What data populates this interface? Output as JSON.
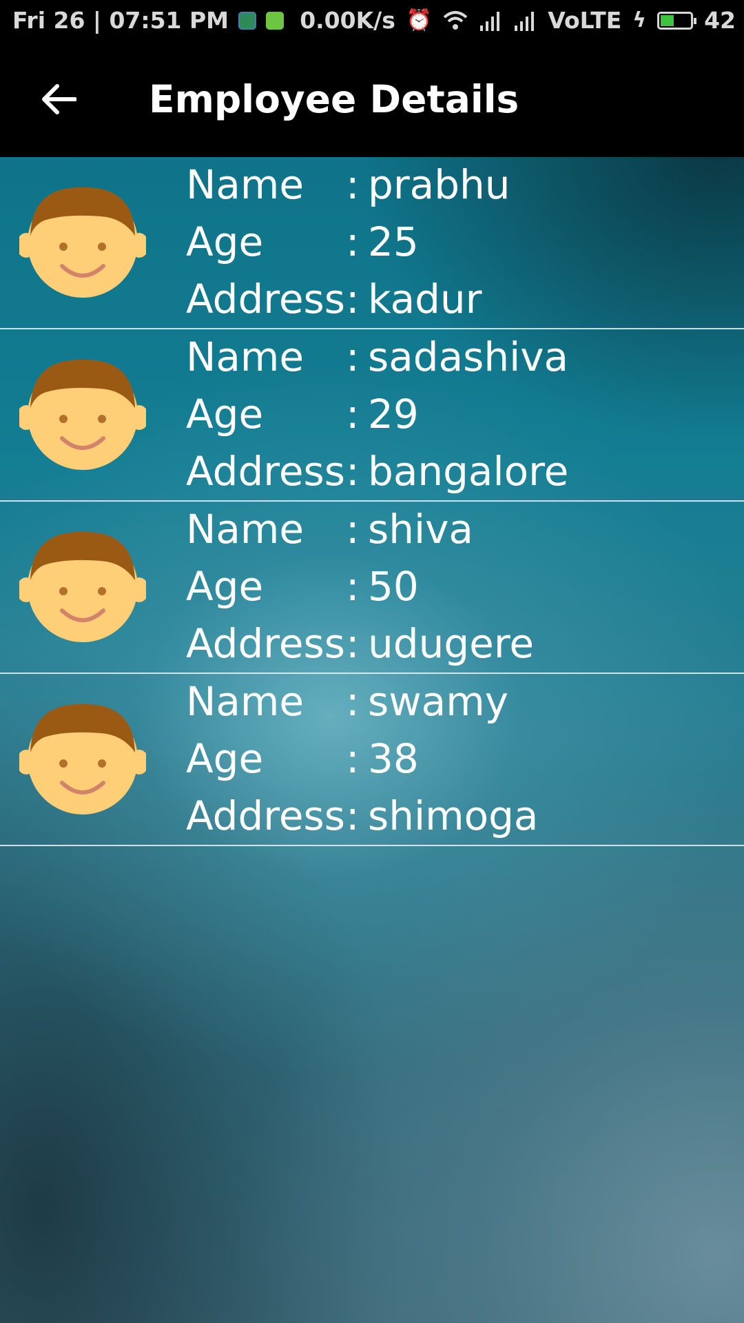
{
  "status_bar": {
    "date_time": "Fri 26 | 07:51 PM",
    "net_speed": "0.00K/s",
    "network_label": "VoLTE",
    "battery_level": "42",
    "icons": [
      "shield-app-icon",
      "android-icon",
      "alarm-icon",
      "wifi-icon",
      "signal-icon",
      "signal-icon",
      "charging-icon",
      "battery-icon"
    ]
  },
  "app_bar": {
    "title": "Employee Details",
    "back_icon": "arrow-left-icon"
  },
  "labels": {
    "name": "Name",
    "age": "Age",
    "address": "Address",
    "separator": ":"
  },
  "employees": [
    {
      "name": "prabhu",
      "age": "25",
      "address": "kadur"
    },
    {
      "name": "sadashiva",
      "age": "29",
      "address": "bangalore"
    },
    {
      "name": "shiva",
      "age": "50",
      "address": "udugere"
    },
    {
      "name": "swamy",
      "age": "38",
      "address": "shimoga"
    }
  ],
  "colors": {
    "app_bar": "#000000",
    "text": "#ffffff",
    "avatar_face": "#fecf76",
    "avatar_hair": "#9b5a14",
    "battery_fill": "#3ec43e"
  }
}
